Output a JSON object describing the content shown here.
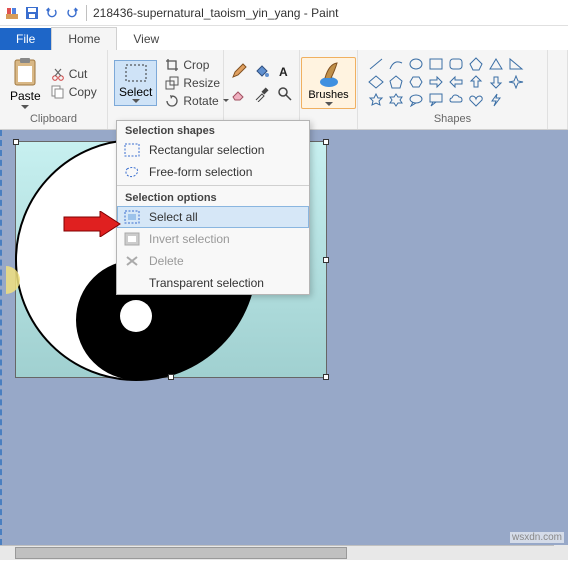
{
  "title": "218436-supernatural_taoism_yin_yang - Paint",
  "tabs": {
    "file": "File",
    "home": "Home",
    "view": "View"
  },
  "clipboard": {
    "paste": "Paste",
    "cut": "Cut",
    "copy": "Copy",
    "label": "Clipboard"
  },
  "image_group": {
    "select": "Select",
    "crop": "Crop",
    "resize": "Resize",
    "rotate": "Rotate"
  },
  "brushes": {
    "label": "Brushes"
  },
  "shapes": {
    "label": "Shapes"
  },
  "dropdown": {
    "shapes_header": "Selection shapes",
    "rect": "Rectangular selection",
    "free": "Free-form selection",
    "options_header": "Selection options",
    "select_all": "Select all",
    "invert": "Invert selection",
    "delete": "Delete",
    "transparent": "Transparent selection"
  },
  "watermark": "wsxdn.com"
}
